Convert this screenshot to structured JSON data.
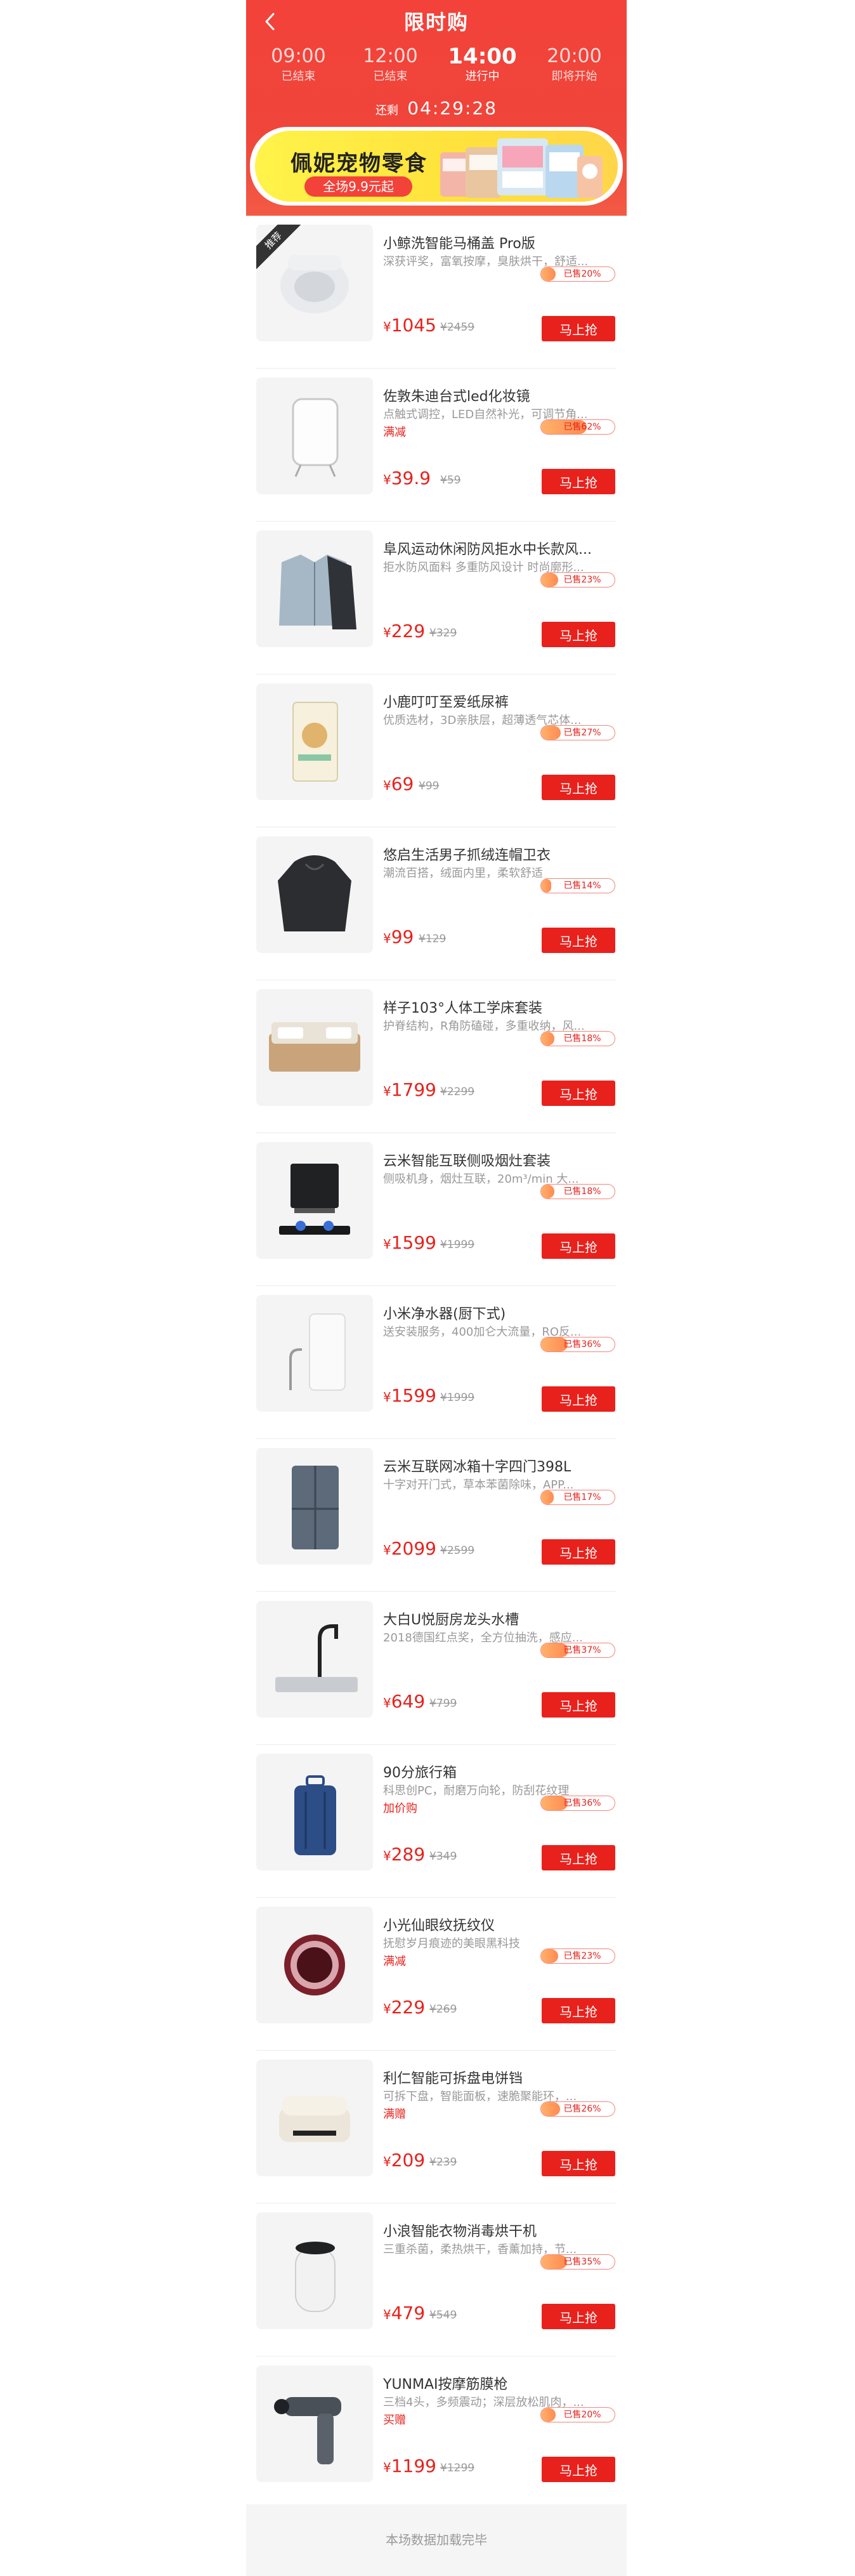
{
  "header": {
    "title": "限时购",
    "slots": [
      {
        "time": "09:00",
        "state": "已结束"
      },
      {
        "time": "12:00",
        "state": "已结束"
      },
      {
        "time": "14:00",
        "state": "进行中"
      },
      {
        "time": "20:00",
        "state": "即将开始"
      }
    ],
    "countdown_label": "还剩",
    "countdown": "04:29:28"
  },
  "banner": {
    "title": "佩妮宠物零食",
    "subtitle": "全场9.9元起"
  },
  "corner_tag": "推荐",
  "products": [
    {
      "name": "小鲸洗智能马桶盖 Pro版",
      "desc": "深获评奖，富氧按摩，臭肤烘干，舒适...",
      "promo": "",
      "sold": "已售20%",
      "sold_pct": 20,
      "price": "1045",
      "orig": "¥2459",
      "icon": "toilet-seat-icon"
    },
    {
      "name": "佐敦朱迪台式led化妆镜",
      "desc": "点触式调控，LED自然补光，可调节角...",
      "promo": "满减",
      "sold": "已售62%",
      "sold_pct": 62,
      "price": "39.9",
      "orig": "¥59",
      "icon": "mirror-icon"
    },
    {
      "name": "阜风运动休闲防风拒水中长款风...",
      "desc": "拒水防风面料 多重防风设计 时尚廓形...",
      "promo": "",
      "sold": "已售23%",
      "sold_pct": 23,
      "price": "229",
      "orig": "¥329",
      "icon": "jacket-icon"
    },
    {
      "name": "小鹿叮叮至爱纸尿裤",
      "desc": "优质选材，3D亲肤层，超薄透气芯体...",
      "promo": "",
      "sold": "已售27%",
      "sold_pct": 27,
      "price": "69",
      "orig": "¥99",
      "icon": "diaper-pack-icon"
    },
    {
      "name": "悠启生活男子抓绒连帽卫衣",
      "desc": "潮流百搭，绒面内里，柔软舒适",
      "promo": "",
      "sold": "已售14%",
      "sold_pct": 14,
      "price": "99",
      "orig": "¥129",
      "icon": "hoodie-icon"
    },
    {
      "name": "样子103°人体工学床套装",
      "desc": "护脊结构，R角防磕碰，多重收纳，风...",
      "promo": "",
      "sold": "已售18%",
      "sold_pct": 18,
      "price": "1799",
      "orig": "¥2299",
      "icon": "bed-icon"
    },
    {
      "name": "云米智能互联侧吸烟灶套装",
      "desc": "侧吸机身，烟灶互联，20m³/min 大...",
      "promo": "",
      "sold": "已售18%",
      "sold_pct": 18,
      "price": "1599",
      "orig": "¥1999",
      "icon": "range-hood-icon"
    },
    {
      "name": "小米净水器(厨下式)",
      "desc": "送安装服务，400加仑大流量，RO反...",
      "promo": "",
      "sold": "已售36%",
      "sold_pct": 36,
      "price": "1599",
      "orig": "¥1999",
      "icon": "water-purifier-icon"
    },
    {
      "name": "云米互联网冰箱十字四门398L",
      "desc": "十字对开门式，草本苯菌除味，APP...",
      "promo": "",
      "sold": "已售17%",
      "sold_pct": 17,
      "price": "2099",
      "orig": "¥2599",
      "icon": "fridge-icon"
    },
    {
      "name": "大白U悦厨房龙头水槽",
      "desc": "2018德国红点奖，全方位抽洗，感应...",
      "promo": "",
      "sold": "已售37%",
      "sold_pct": 37,
      "price": "649",
      "orig": "¥799",
      "icon": "sink-faucet-icon"
    },
    {
      "name": "90分旅行箱",
      "desc": "科思创PC，耐磨万向轮，防刮花纹理",
      "promo": "加价购",
      "sold": "已售36%",
      "sold_pct": 36,
      "price": "289",
      "orig": "¥349",
      "icon": "suitcase-icon"
    },
    {
      "name": "小光仙眼纹抚纹仪",
      "desc": "抚慰岁月痕迹的美眼黑科技",
      "promo": "满减",
      "sold": "已售23%",
      "sold_pct": 23,
      "price": "229",
      "orig": "¥269",
      "icon": "eye-massager-icon"
    },
    {
      "name": "利仁智能可拆盘电饼铛",
      "desc": "可拆下盘，智能面板，速脆聚能环，...",
      "promo": "满赠",
      "sold": "已售26%",
      "sold_pct": 26,
      "price": "209",
      "orig": "¥239",
      "icon": "griddle-icon"
    },
    {
      "name": "小浪智能衣物消毒烘干机",
      "desc": "三重杀菌，柔热烘干，香薰加持，节...",
      "promo": "",
      "sold": "已售35%",
      "sold_pct": 35,
      "price": "479",
      "orig": "¥549",
      "icon": "dryer-icon"
    },
    {
      "name": "YUNMAI按摩筋膜枪",
      "desc": "三档4头，多频震动；深层放松肌肉，...",
      "promo": "买赠",
      "sold": "已售20%",
      "sold_pct": 20,
      "price": "1199",
      "orig": "¥1299",
      "icon": "massage-gun-icon"
    }
  ],
  "buy_label": "马上抢",
  "currency": "¥",
  "footer": "本场数据加载完毕",
  "colors": {
    "brand": "#f2423a",
    "price": "#e8211c",
    "banner": "#fff34a"
  }
}
